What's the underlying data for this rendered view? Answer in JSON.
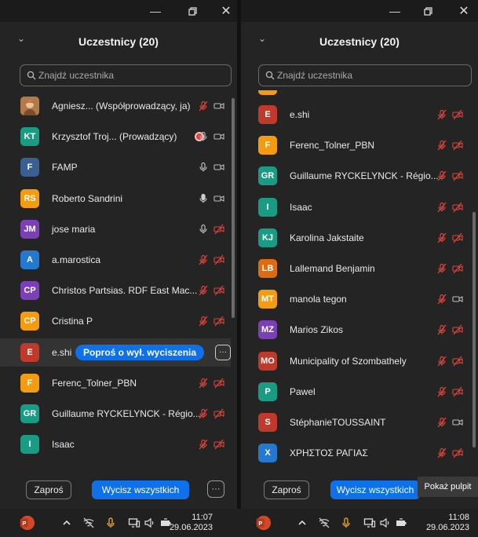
{
  "window_left": {
    "title": "Uczestnicy (20)",
    "search_placeholder": "Znajdź uczestnika",
    "participants": [
      {
        "initials": "",
        "name": "Agniesz... (Współprowadzący, ja)",
        "color": "#c98a55",
        "photo": true,
        "mic": "muted",
        "video": "on"
      },
      {
        "initials": "KT",
        "name": "Krzysztof Troj... (Prowadzący)",
        "color": "#1a9c84",
        "mic": "on",
        "video": "on",
        "badge": true
      },
      {
        "initials": "F",
        "name": "FAMP",
        "color": "#3b5e93",
        "mic": "on",
        "video": "on"
      },
      {
        "initials": "RS",
        "name": "Roberto Sandrini",
        "color": "#f39c12",
        "mic": "speaking",
        "video": "on"
      },
      {
        "initials": "JM",
        "name": "jose maria",
        "color": "#7d3fb8",
        "mic": "on",
        "video": "off"
      },
      {
        "initials": "A",
        "name": "a.marostica",
        "color": "#2478cf",
        "mic": "muted",
        "video": "off"
      },
      {
        "initials": "CP",
        "name": "Christos Partsias. RDF East Mac...",
        "color": "#7d3fb8",
        "mic": "muted",
        "video": "off"
      },
      {
        "initials": "CP",
        "name": "Cristina P",
        "color": "#f39c12",
        "mic": "muted",
        "video": "off"
      },
      {
        "initials": "E",
        "name": "e.shi",
        "color": "#c0392b",
        "hover": true
      },
      {
        "initials": "F",
        "name": "Ferenc_Tolner_PBN",
        "color": "#f39c12",
        "mic": "muted",
        "video": "off"
      },
      {
        "initials": "GR",
        "name": "Guillaume RYCKELYNCK - Régio...",
        "color": "#1a9c84",
        "mic": "muted",
        "video": "off"
      },
      {
        "initials": "I",
        "name": "Isaac",
        "color": "#1a9c84",
        "mic": "muted",
        "video": "off"
      }
    ],
    "hover_action": "Poproś o wył. wyciszenia",
    "invite_label": "Zaproś",
    "mute_all_label": "Wycisz wszystkich",
    "clock_time": "11:07",
    "clock_date": "29.06.2023"
  },
  "window_right": {
    "title": "Uczestnicy (20)",
    "search_placeholder": "Znajdź uczestnika",
    "participants": [
      {
        "initials": "E",
        "name": "e.shi",
        "color": "#c0392b",
        "mic": "muted",
        "video": "off"
      },
      {
        "initials": "F",
        "name": "Ferenc_Tolner_PBN",
        "color": "#f39c12",
        "mic": "muted",
        "video": "off"
      },
      {
        "initials": "GR",
        "name": "Guillaume RYCKELYNCK - Régio...",
        "color": "#1a9c84",
        "mic": "muted",
        "video": "off"
      },
      {
        "initials": "I",
        "name": "Isaac",
        "color": "#1a9c84",
        "mic": "muted",
        "video": "off"
      },
      {
        "initials": "KJ",
        "name": "Karolina Jakstaite",
        "color": "#1a9c84",
        "mic": "muted",
        "video": "off"
      },
      {
        "initials": "LB",
        "name": "Lallemand Benjamin",
        "color": "#e06a10",
        "mic": "muted",
        "video": "off"
      },
      {
        "initials": "MT",
        "name": "manola tegon",
        "color": "#f39c12",
        "mic": "muted",
        "video": "on"
      },
      {
        "initials": "MZ",
        "name": "Marios Zikos",
        "color": "#7d3fb8",
        "mic": "muted",
        "video": "off"
      },
      {
        "initials": "MO",
        "name": "Municipality of Szombathely",
        "color": "#c0392b",
        "mic": "muted",
        "video": "off"
      },
      {
        "initials": "P",
        "name": "Pawel",
        "color": "#1a9c84",
        "mic": "muted",
        "video": "off"
      },
      {
        "initials": "S",
        "name": "StéphanieTOUSSAINT",
        "color": "#c0392b",
        "mic": "muted",
        "video": "on"
      },
      {
        "initials": "X",
        "name": "ΧΡΗΣΤΟΣ ΡΑΓΙΑΣ",
        "color": "#2478cf",
        "mic": "muted",
        "video": "off"
      }
    ],
    "invite_label": "Zaproś",
    "mute_all_label": "Wycisz wszystkich",
    "tooltip": "Pokaż pulpit",
    "clock_time": "11:08",
    "clock_date": "29.06.2023"
  },
  "colors": {
    "accent": "#0e71eb",
    "muted_red": "#e0443a"
  }
}
